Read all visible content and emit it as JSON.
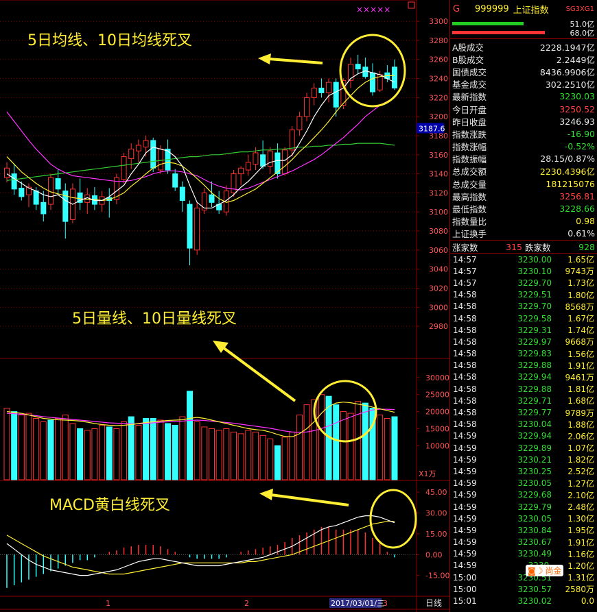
{
  "header": {
    "market_code": "G",
    "symbol": "999999",
    "name": "上证指数",
    "tag": "SG3XG1"
  },
  "strength_bars": {
    "up_amount": "51.0亿",
    "down_amount": "68.0亿",
    "up_fraction": 0.5,
    "down_fraction": 0.65
  },
  "stats": [
    {
      "label": "A股成交",
      "value": "2228.1947亿",
      "color": "#e8e8e8"
    },
    {
      "label": "B股成交",
      "value": "2.2449亿",
      "color": "#e8e8e8"
    },
    {
      "label": "国债成交",
      "value": "8436.9906亿",
      "color": "#e8e8e8"
    },
    {
      "label": "基金成交",
      "value": "302.2510亿",
      "color": "#e8e8e8"
    },
    {
      "label": "最新指数",
      "value": "3230.03",
      "color": "#33dd33"
    },
    {
      "label": "今日开盘",
      "value": "3250.52",
      "color": "#ff4444"
    },
    {
      "label": "昨日收盘",
      "value": "3246.93",
      "color": "#e8e8e8"
    },
    {
      "label": "指数涨跌",
      "value": "-16.90",
      "color": "#33dd33"
    },
    {
      "label": "指数涨幅",
      "value": "-0.52%",
      "color": "#33dd33"
    },
    {
      "label": "指数振幅",
      "value": "28.15/0.87%",
      "color": "#e8e8e8"
    },
    {
      "label": "总成交额",
      "value": "2230.4396亿",
      "color": "#ffee33"
    },
    {
      "label": "总成交量",
      "value": "181215076",
      "color": "#ffee33"
    },
    {
      "label": "最高指数",
      "value": "3256.81",
      "color": "#ff4444"
    },
    {
      "label": "最低指数",
      "value": "3228.66",
      "color": "#33dd33"
    },
    {
      "label": "指数量比",
      "value": "0.98",
      "color": "#ffee33"
    },
    {
      "label": "上证换手",
      "value": "0.61%",
      "color": "#e8e8e8"
    }
  ],
  "breadth": {
    "up_label": "涨家数",
    "up_count": "315",
    "down_label": "跌家数",
    "down_count": "928"
  },
  "ticks": [
    [
      "14:57",
      "3230.00",
      "1.65亿"
    ],
    [
      "14:57",
      "3230.10",
      "9743万"
    ],
    [
      "14:57",
      "3229.70",
      "1.73亿"
    ],
    [
      "14:58",
      "3229.51",
      "1.80亿"
    ],
    [
      "14:58",
      "3229.70",
      "8568万"
    ],
    [
      "14:58",
      "3229.58",
      "1.67亿"
    ],
    [
      "14:58",
      "3229.31",
      "1.74亿"
    ],
    [
      "14:58",
      "3229.97",
      "9668万"
    ],
    [
      "14:58",
      "3229.83",
      "1.56亿"
    ],
    [
      "14:58",
      "3229.88",
      "1.91亿"
    ],
    [
      "14:58",
      "3229.94",
      "9461万"
    ],
    [
      "14:58",
      "3229.88",
      "1.81亿"
    ],
    [
      "14:58",
      "3229.71",
      "1.68亿"
    ],
    [
      "14:58",
      "3229.77",
      "9789万"
    ],
    [
      "14:58",
      "3230.04",
      "1.88亿"
    ],
    [
      "14:59",
      "3229.94",
      "2.06亿"
    ],
    [
      "14:59",
      "3229.89",
      "1.07亿"
    ],
    [
      "14:59",
      "3230.21",
      "1.82亿"
    ],
    [
      "14:59",
      "3230.25",
      "2.52亿"
    ],
    [
      "14:59",
      "3230.05",
      "1.27亿"
    ],
    [
      "14:59",
      "3229.68",
      "2.10亿"
    ],
    [
      "14:59",
      "3229.79",
      "2.48亿"
    ],
    [
      "14:59",
      "3230.05",
      "1.30亿"
    ],
    [
      "14:59",
      "3230.84",
      "1.95亿"
    ],
    [
      "14:59",
      "3230.67",
      "1.91亿"
    ],
    [
      "14:59",
      "3230.49",
      "1.16亿"
    ],
    [
      "14:59",
      "3230.",
      "1.20亿"
    ],
    [
      "15:00",
      "3230.51",
      "1.31亿"
    ],
    [
      "15:00",
      "3230.57",
      "2580万"
    ],
    [
      "15:01",
      "3230.02",
      "0.0"
    ]
  ],
  "watermark": "尚金",
  "annotations": {
    "price": "5日均线、10日均线死叉",
    "volume": "5日量线、10日量线死叉",
    "macd": "MACD黄白线死叉"
  },
  "price_axis": {
    "ticks": [
      "3300",
      "3280",
      "3260",
      "3240",
      "3220",
      "3200",
      "3180",
      "3160",
      "3140",
      "3120",
      "3100",
      "3080",
      "3060",
      "3040",
      "3020",
      "3000",
      "2980"
    ],
    "current": "3187.6"
  },
  "volume_axis": {
    "ticks": [
      "30000",
      "25000",
      "20000",
      "15000",
      "10000"
    ],
    "unit": "X1万"
  },
  "macd_axis": {
    "ticks": [
      "45.00",
      "30.00",
      "15.00",
      "0.00",
      "-15.00"
    ]
  },
  "date_axis": {
    "labels": [
      "1",
      "2",
      "3"
    ],
    "date_badge": "2017/03/01/三",
    "period": "日线"
  },
  "markers": "×××××",
  "colors": {
    "up": "#ff3333",
    "down": "#33ffff",
    "ma5": "#ffffff",
    "ma10": "#ffee33",
    "ma20": "#ff33ff",
    "ma60": "#33cc33",
    "grid": "#8b0000",
    "annotation": "#ffee33"
  },
  "chart_data": [
    {
      "type": "candlestick",
      "title": "",
      "ohlc": [
        [
          3136,
          3152,
          3131,
          3146
        ],
        [
          3140,
          3150,
          3118,
          3124
        ],
        [
          3125,
          3132,
          3112,
          3116
        ],
        [
          3118,
          3130,
          3105,
          3126
        ],
        [
          3122,
          3126,
          3102,
          3108
        ],
        [
          3110,
          3122,
          3090,
          3098
        ],
        [
          3108,
          3140,
          3102,
          3136
        ],
        [
          3135,
          3145,
          3118,
          3124
        ],
        [
          3122,
          3130,
          3072,
          3090
        ],
        [
          3092,
          3130,
          3088,
          3124
        ],
        [
          3120,
          3135,
          3102,
          3110
        ],
        [
          3110,
          3125,
          3098,
          3118
        ],
        [
          3117,
          3126,
          3102,
          3108
        ],
        [
          3108,
          3122,
          3100,
          3116
        ],
        [
          3115,
          3125,
          3094,
          3112
        ],
        [
          3113,
          3140,
          3108,
          3136
        ],
        [
          3134,
          3162,
          3130,
          3158
        ],
        [
          3156,
          3172,
          3145,
          3166
        ],
        [
          3164,
          3176,
          3152,
          3170
        ],
        [
          3168,
          3180,
          3158,
          3175
        ],
        [
          3175,
          3178,
          3142,
          3146
        ],
        [
          3144,
          3170,
          3140,
          3166
        ],
        [
          3166,
          3176,
          3140,
          3144
        ],
        [
          3140,
          3145,
          3122,
          3126
        ],
        [
          3126,
          3132,
          3100,
          3112
        ],
        [
          3108,
          3112,
          3044,
          3062
        ],
        [
          3060,
          3110,
          3055,
          3104
        ],
        [
          3102,
          3125,
          3098,
          3120
        ],
        [
          3118,
          3132,
          3105,
          3110
        ],
        [
          3108,
          3122,
          3098,
          3102
        ],
        [
          3100,
          3128,
          3096,
          3122
        ],
        [
          3120,
          3144,
          3116,
          3140
        ],
        [
          3140,
          3148,
          3128,
          3146
        ],
        [
          3144,
          3160,
          3138,
          3152
        ],
        [
          3150,
          3168,
          3144,
          3162
        ],
        [
          3160,
          3175,
          3145,
          3148
        ],
        [
          3148,
          3168,
          3140,
          3164
        ],
        [
          3162,
          3172,
          3135,
          3140
        ],
        [
          3140,
          3168,
          3138,
          3165
        ],
        [
          3165,
          3190,
          3158,
          3186
        ],
        [
          3186,
          3205,
          3180,
          3200
        ],
        [
          3200,
          3225,
          3195,
          3220
        ],
        [
          3220,
          3235,
          3212,
          3230
        ],
        [
          3230,
          3240,
          3220,
          3225
        ],
        [
          3225,
          3240,
          3215,
          3236
        ],
        [
          3236,
          3240,
          3200,
          3210
        ],
        [
          3212,
          3240,
          3208,
          3238
        ],
        [
          3238,
          3262,
          3230,
          3255
        ],
        [
          3255,
          3265,
          3245,
          3250
        ],
        [
          3252,
          3262,
          3240,
          3242
        ],
        [
          3246,
          3256,
          3222,
          3226
        ],
        [
          3228,
          3248,
          3226,
          3244
        ],
        [
          3246,
          3254,
          3236,
          3240
        ],
        [
          3252,
          3260,
          3228,
          3230
        ]
      ],
      "ma5": [
        3140,
        3135,
        3130,
        3125,
        3122,
        3118,
        3116,
        3118,
        3112,
        3108,
        3112,
        3115,
        3112,
        3112,
        3116,
        3122,
        3128,
        3140,
        3150,
        3162,
        3168,
        3166,
        3164,
        3158,
        3148,
        3128,
        3110,
        3104,
        3104,
        3108,
        3112,
        3118,
        3126,
        3132,
        3140,
        3148,
        3152,
        3154,
        3154,
        3160,
        3172,
        3185,
        3200,
        3212,
        3222,
        3226,
        3230,
        3240,
        3245,
        3248,
        3246,
        3244,
        3240,
        3236
      ],
      "ma10": [
        3158,
        3150,
        3142,
        3136,
        3130,
        3125,
        3121,
        3119,
        3117,
        3115,
        3114,
        3113,
        3113,
        3112,
        3113,
        3116,
        3120,
        3127,
        3133,
        3140,
        3146,
        3150,
        3152,
        3151,
        3148,
        3142,
        3135,
        3128,
        3120,
        3114,
        3110,
        3112,
        3116,
        3120,
        3124,
        3130,
        3136,
        3142,
        3148,
        3155,
        3163,
        3170,
        3178,
        3186,
        3195,
        3205,
        3214,
        3222,
        3230,
        3236,
        3240,
        3242,
        3243,
        3243
      ],
      "ma20": [
        3205,
        3195,
        3185,
        3175,
        3166,
        3158,
        3150,
        3145,
        3141,
        3138,
        3137,
        3136,
        3135,
        3134,
        3133,
        3132,
        3132,
        3133,
        3135,
        3137,
        3140,
        3142,
        3143,
        3143,
        3142,
        3140,
        3138,
        3134,
        3130,
        3127,
        3125,
        3124,
        3123,
        3125,
        3128,
        3131,
        3134,
        3137,
        3140,
        3143,
        3147,
        3151,
        3155,
        3160,
        3166,
        3172,
        3178,
        3185,
        3192,
        3200,
        3206,
        3212,
        3216,
        3220
      ],
      "ma60": [
        3133,
        3134,
        3135,
        3136,
        3137,
        3138,
        3139,
        3140,
        3141,
        3142,
        3143,
        3144,
        3145,
        3146,
        3147,
        3148,
        3149,
        3150,
        3151,
        3152,
        3153,
        3154,
        3155,
        3156,
        3157,
        3158,
        3158,
        3159,
        3160,
        3160,
        3161,
        3162,
        3163,
        3163,
        3164,
        3165,
        3165,
        3166,
        3166,
        3167,
        3168,
        3168,
        3169,
        3169,
        3170,
        3170,
        3171,
        3171,
        3172,
        3172,
        3172,
        3172,
        3171,
        3170
      ],
      "ylim": [
        2970,
        3308
      ]
    },
    {
      "type": "bar",
      "title": "",
      "values": [
        21000,
        20000,
        19000,
        19500,
        18000,
        17000,
        17500,
        18000,
        19000,
        16500,
        15000,
        14500,
        15000,
        16000,
        15500,
        15000,
        17000,
        18500,
        16000,
        18000,
        18000,
        17500,
        16500,
        16000,
        18500,
        26000,
        17000,
        15500,
        15000,
        14500,
        15000,
        14000,
        13500,
        14500,
        14000,
        13000,
        12000,
        10000,
        12500,
        14000,
        19000,
        22000,
        23500,
        25000,
        24500,
        22000,
        20000,
        19500,
        23000,
        22500,
        21000,
        19000,
        18000,
        18500
      ],
      "up": [
        1,
        0,
        1,
        1,
        1,
        1,
        0,
        1,
        1,
        1,
        0,
        1,
        1,
        1,
        0,
        1,
        1,
        0,
        1,
        0,
        0,
        1,
        0,
        0,
        1,
        0,
        1,
        1,
        1,
        1,
        1,
        1,
        1,
        1,
        1,
        1,
        1,
        0,
        1,
        1,
        1,
        1,
        1,
        1,
        0,
        0,
        1,
        1,
        1,
        0,
        0,
        1,
        1,
        0
      ],
      "ma5": [
        20000,
        19800,
        19500,
        19000,
        18500,
        18000,
        17800,
        17600,
        17500,
        17400,
        17200,
        16900,
        16500,
        16200,
        16000,
        15900,
        16000,
        16200,
        16500,
        16800,
        17000,
        17200,
        17400,
        17500,
        17600,
        18000,
        18300,
        18000,
        17500,
        17000,
        16500,
        16000,
        15500,
        15000,
        14700,
        14500,
        14000,
        13300,
        12700,
        12600,
        13500,
        15000,
        17000,
        19500,
        21500,
        22500,
        22800,
        22600,
        22200,
        21800,
        21300,
        20800,
        20300,
        19800
      ],
      "ma10": [
        19500,
        19400,
        19200,
        19000,
        18800,
        18500,
        18300,
        18100,
        17900,
        17700,
        17500,
        17300,
        17100,
        16900,
        16700,
        16600,
        16500,
        16400,
        16400,
        16500,
        16700,
        16900,
        17000,
        17100,
        17200,
        17400,
        17500,
        17400,
        17200,
        17000,
        16800,
        16600,
        16300,
        16000,
        15700,
        15400,
        15100,
        14700,
        14300,
        14000,
        13900,
        14000,
        14400,
        15000,
        15800,
        16700,
        17600,
        18400,
        19200,
        19900,
        20500,
        20700,
        20700,
        20600
      ],
      "ylim": [
        0,
        35000
      ]
    },
    {
      "type": "macd",
      "title": "",
      "dif": [
        8,
        4,
        0,
        -4,
        -7,
        -9,
        -11,
        -12,
        -13,
        -14,
        -15,
        -15,
        -14,
        -13,
        -12,
        -11,
        -9,
        -7,
        -5,
        -4,
        -3,
        -3,
        -4,
        -5,
        -6,
        -7,
        -8,
        -8,
        -8,
        -8,
        -7,
        -6,
        -5,
        -4,
        -3,
        -2,
        0,
        2,
        4,
        6,
        9,
        12,
        15,
        18,
        20,
        21,
        23,
        25,
        27,
        28,
        28,
        27,
        25,
        23
      ],
      "dea": [
        14,
        11,
        8,
        5,
        2,
        -1,
        -3,
        -5,
        -7,
        -9,
        -10,
        -11,
        -12,
        -13,
        -14,
        -14,
        -14,
        -13,
        -12,
        -11,
        -10,
        -9,
        -8,
        -7,
        -6,
        -6,
        -6,
        -6,
        -6,
        -6,
        -6,
        -6,
        -6,
        -5,
        -5,
        -4,
        -3,
        -2,
        -1,
        0,
        2,
        4,
        6,
        8,
        10,
        12,
        14,
        16,
        18,
        20,
        22,
        23,
        24,
        24
      ],
      "hist": [
        -24,
        -22,
        -20,
        -18,
        -16,
        -14,
        -12,
        -10,
        -8,
        -6,
        -4,
        -4,
        -2,
        0,
        2,
        3,
        5,
        6,
        7,
        7,
        7,
        6,
        4,
        2,
        0,
        -2,
        -3,
        -3,
        -3,
        -3,
        -2,
        0,
        2,
        3,
        4,
        5,
        6,
        7,
        9,
        12,
        14,
        16,
        18,
        20,
        20,
        18,
        18,
        18,
        18,
        16,
        12,
        8,
        2,
        -2
      ],
      "ylim": [
        -30,
        52
      ]
    }
  ]
}
